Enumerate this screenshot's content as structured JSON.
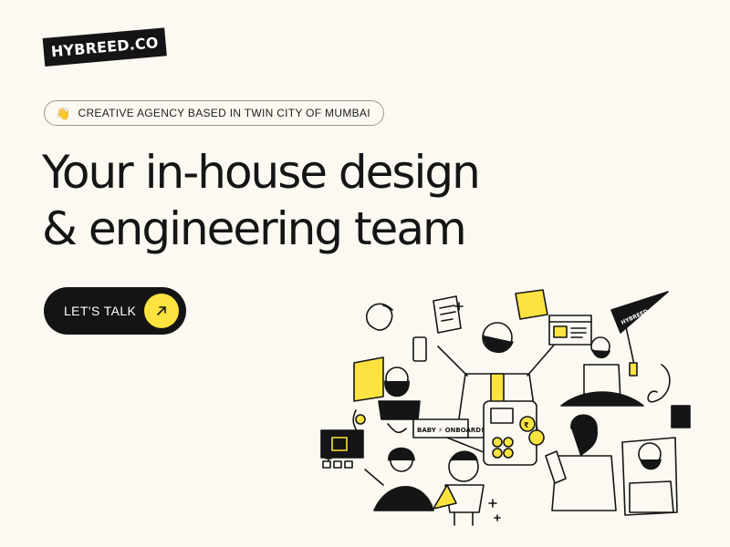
{
  "brand": {
    "logo_text": "HYBREED.CO"
  },
  "hero": {
    "tagline_icon": "waving-hand-icon",
    "tagline_emoji": "👋",
    "tagline": "CREATIVE AGENCY BASED IN TWIN CITY OF MUMBAI",
    "headline_line1": "Your in-house design",
    "headline_line2": "& engineering team",
    "cta_label": "LET'S TALK",
    "cta_icon": "arrow-up-right-icon"
  },
  "illustration": {
    "sign_text": "BABY ⚡ ONBOARD!",
    "flag_text": "HYBREED",
    "coin_symbol": "₹"
  },
  "colors": {
    "background": "#fbf9f1",
    "ink": "#151515",
    "accent_yellow": "#fde33f"
  }
}
